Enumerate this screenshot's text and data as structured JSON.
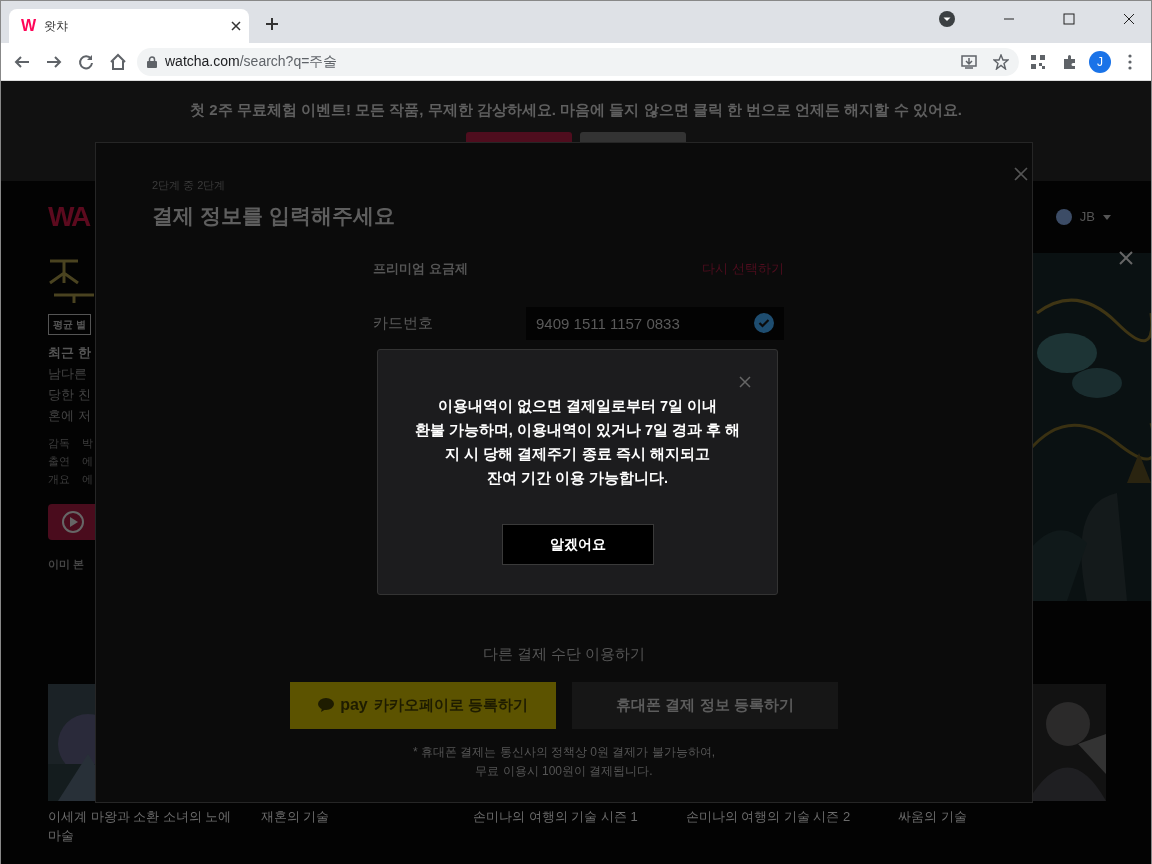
{
  "browser": {
    "tab_favicon": "W",
    "tab_title": "왓챠",
    "url_host": "watcha.com",
    "url_path": "/search?q=주술",
    "profile_initial": "J"
  },
  "page": {
    "banner_text": "첫 2주 무료체험 이벤트! 모든 작품, 무제한 감상하세요. 마음에 들지 않으면 클릭 한 번으로 언제든 해지할 수 있어요.",
    "logo": "WA",
    "user_name": "JB",
    "rating_badge": "평균 별",
    "summary_lines": [
      "최근 한",
      "남다른",
      "당한 친",
      "혼에 저"
    ],
    "credits": [
      {
        "label": "감독",
        "value": "박"
      },
      {
        "label": "출연",
        "value": "에"
      },
      {
        "label": "개요",
        "value": "에"
      }
    ],
    "watched_text": "이미 본",
    "posters": [
      {
        "title": "이세계 마왕과 소환 소녀의 노에 마술",
        "kind": "picture"
      },
      {
        "title": "재혼의 기술",
        "kind": "hidden"
      },
      {
        "title": "손미나의 여행의 기술 시즌 1",
        "kind": "hidden"
      },
      {
        "title": "손미나의 여행의 기술 시즌 2",
        "kind": "hidden"
      },
      {
        "title": "싸움의 기술",
        "kind": "picture"
      }
    ]
  },
  "payment_modal": {
    "step": "2단계 중 2단계",
    "title": "결제 정보를 입력해주세요",
    "plan_label": "프리미엄 요금제",
    "reselect_link": "다시 선택하기",
    "card_label": "카드번호",
    "card_number": "9409 1511 1157 0833",
    "card_verified": true,
    "other_methods_label": "다른 결제 수단 이용하기",
    "kakao_logo": "pay",
    "kakao_button": "카카오페이로 등록하기",
    "phone_button": "휴대폰 결제 정보 등록하기",
    "note_lines": [
      "* 휴대폰 결제는 통신사의 정책상 0원 결제가 불가능하여,",
      "무료 이용시 100원이 결제됩니다."
    ]
  },
  "alert": {
    "message_lines": [
      "이용내역이 없으면 결제일로부터 7일 이내",
      "환불 가능하며, 이용내역이 있거나 7일 경과 후 해",
      "지 시 당해 결제주기 종료 즉시 해지되고",
      "잔여 기간 이용 가능합니다."
    ],
    "confirm_button": "알겠어요"
  }
}
